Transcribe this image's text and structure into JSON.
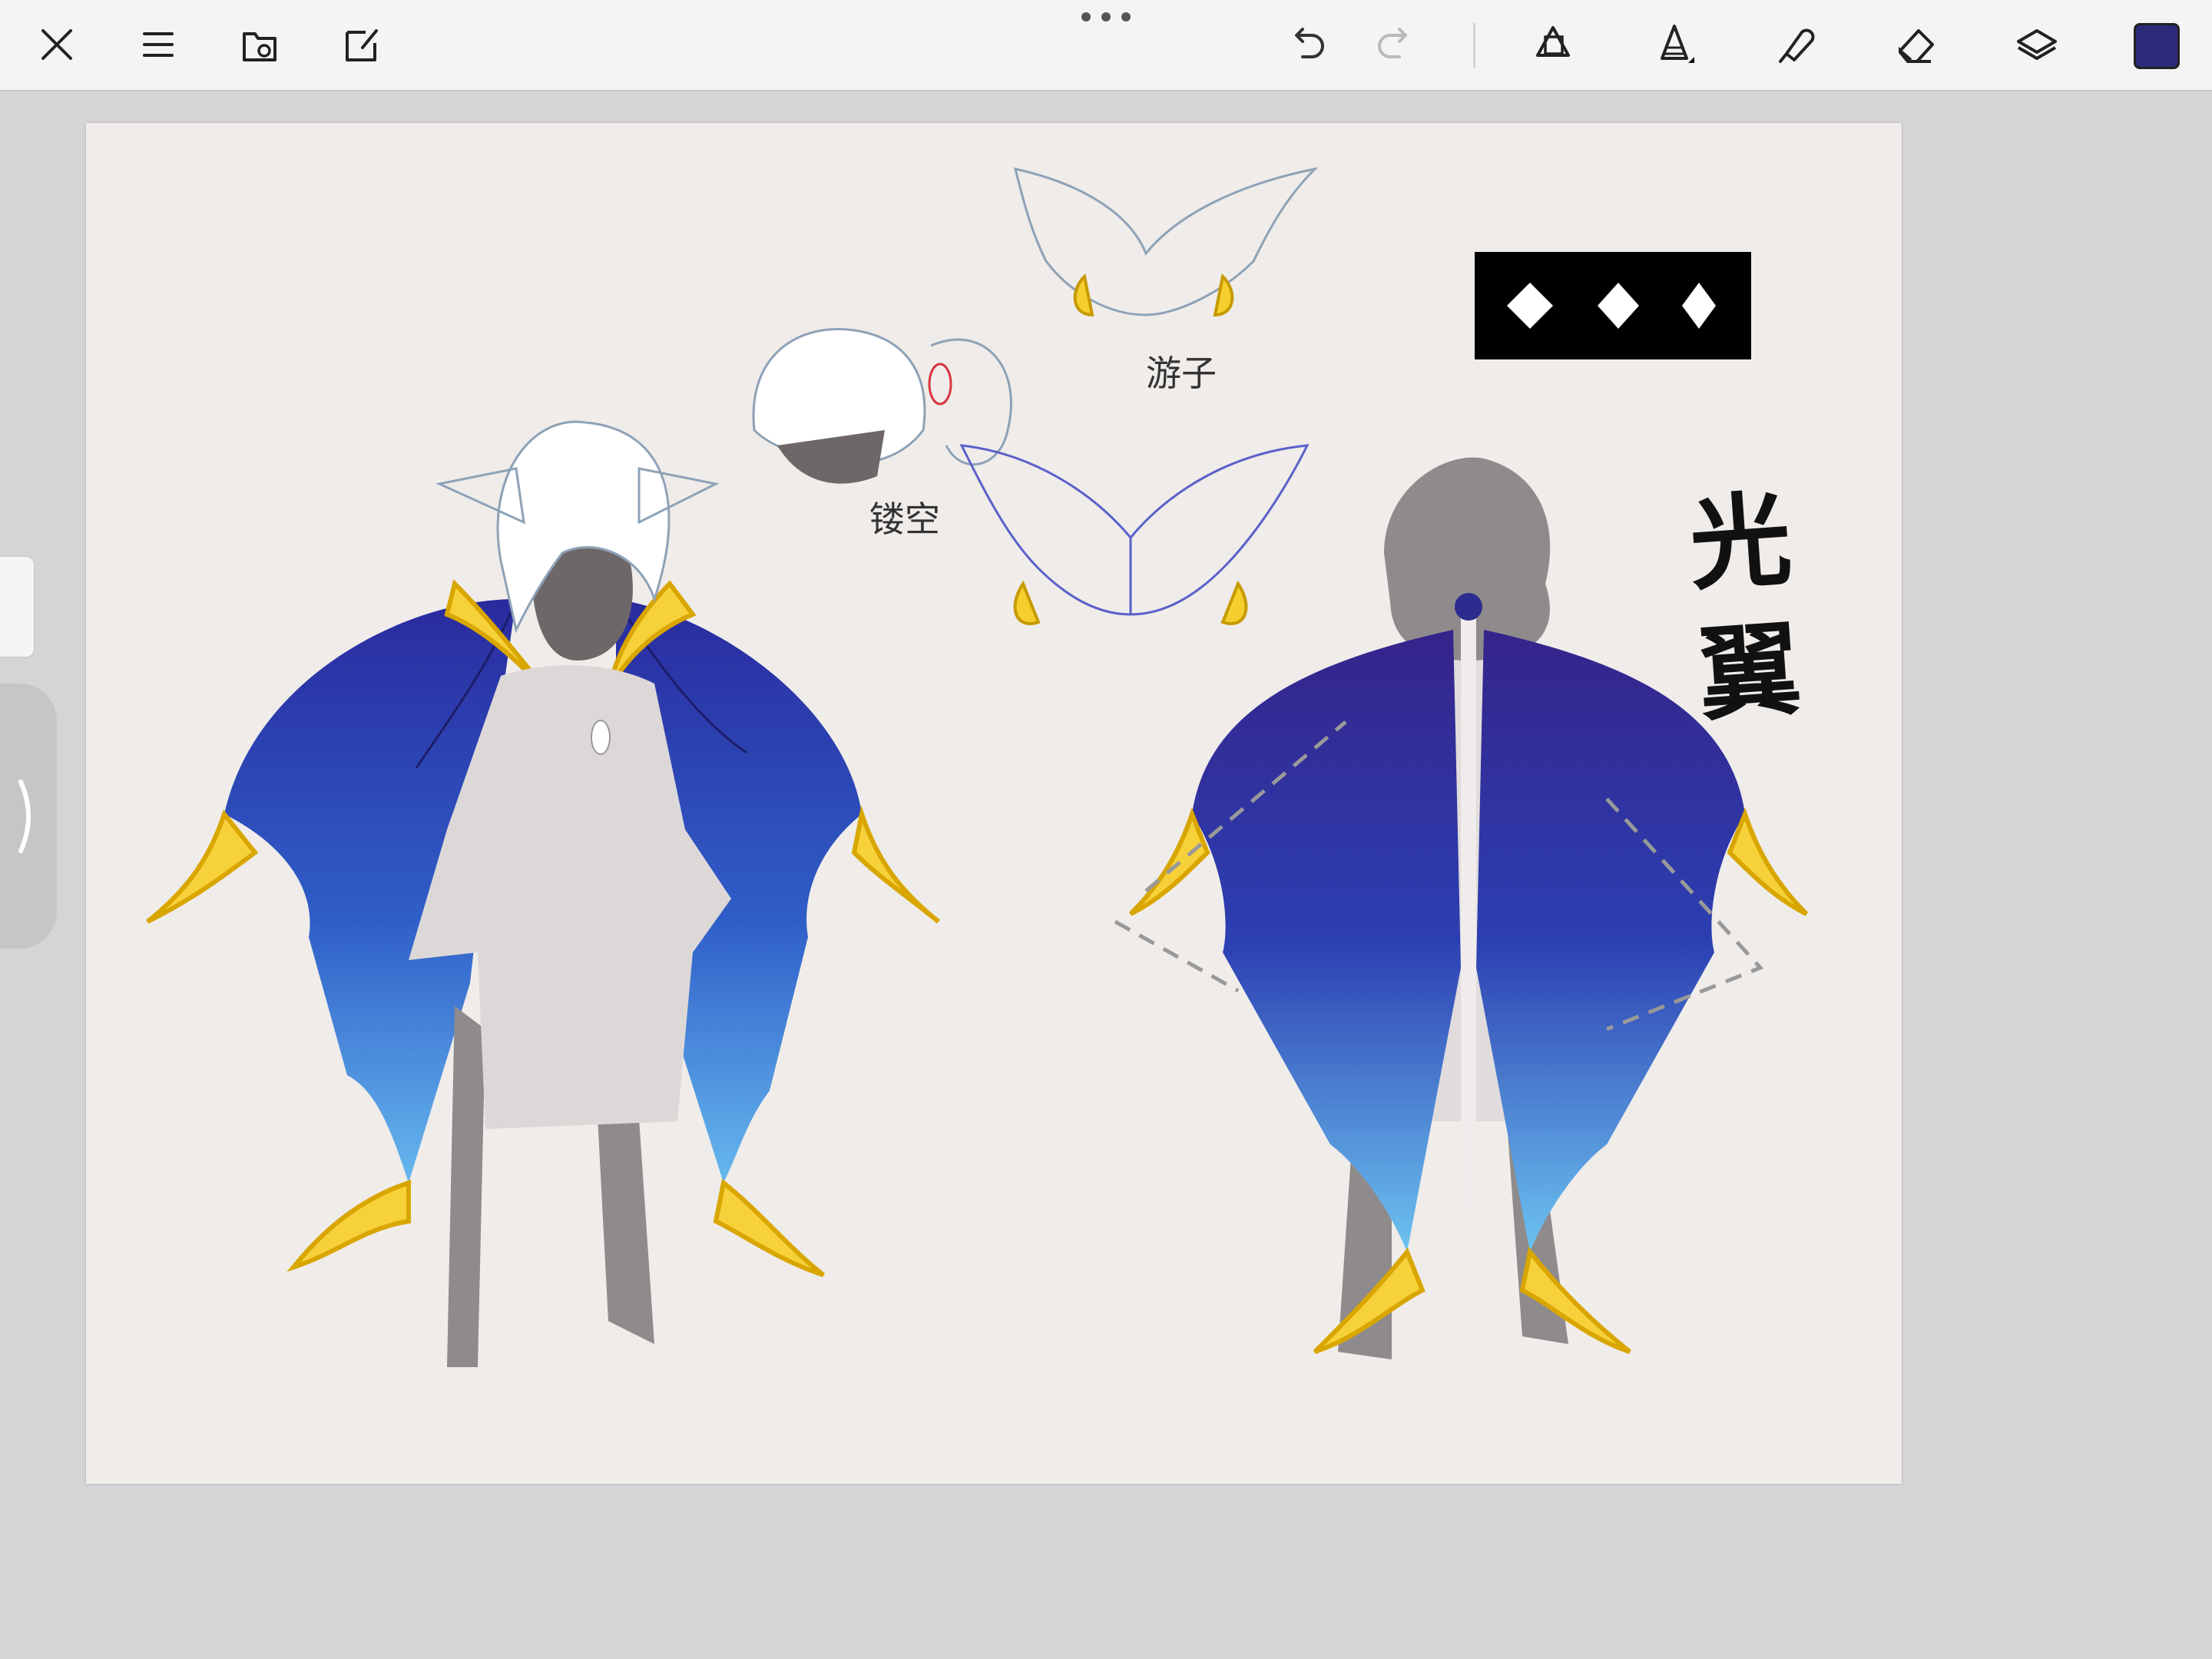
{
  "toolbar": {
    "close_icon": "close-icon",
    "menu_icon": "menu-icon",
    "gallery_icon": "folder-icon",
    "share_icon": "export-icon",
    "undo_icon": "undo-icon",
    "redo_icon": "redo-icon",
    "select_icon": "selection-icon",
    "brush_icon": "brush-icon",
    "smudge_icon": "smudge-icon",
    "eraser_icon": "eraser-icon",
    "layers_icon": "layers-icon",
    "current_color": "#2d2a7c"
  },
  "canvas": {
    "title": "光翼",
    "note_hollow": "镂空",
    "note_other": "游子",
    "background": "#efecea",
    "wing_colors": [
      "#2b2fa8",
      "#5aa3e8",
      "#f5cf2a"
    ]
  }
}
